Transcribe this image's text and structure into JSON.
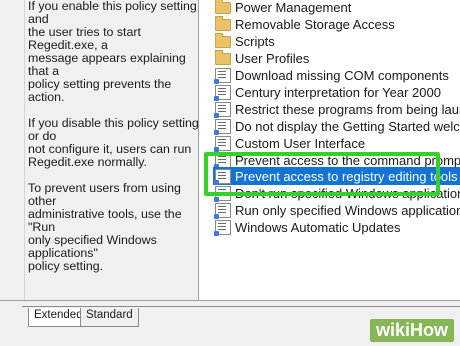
{
  "description": {
    "paragraphs": [
      "If you enable this policy setting and\nthe user tries to start Regedit.exe, a\nmessage appears explaining that a\npolicy setting prevents the action.",
      "If you disable this policy setting or do\nnot configure it, users can run\nRegedit.exe normally.",
      "To prevent users from using other\nadministrative tools, use the \"Run\nonly specified Windows applications\"\npolicy setting."
    ]
  },
  "list": {
    "items": [
      {
        "label": "Power Management",
        "icon": "folder-icon",
        "selected": false
      },
      {
        "label": "Removable Storage Access",
        "icon": "folder-icon",
        "selected": false
      },
      {
        "label": "Scripts",
        "icon": "folder-icon",
        "selected": false
      },
      {
        "label": "User Profiles",
        "icon": "folder-icon",
        "selected": false
      },
      {
        "label": "Download missing COM components",
        "icon": "setting-icon",
        "selected": false
      },
      {
        "label": "Century interpretation for Year 2000",
        "icon": "setting-icon",
        "selected": false
      },
      {
        "label": "Restrict these programs from being launched from",
        "icon": "setting-icon",
        "selected": false
      },
      {
        "label": "Do not display the Getting Started welcome screen",
        "icon": "setting-icon",
        "selected": false
      },
      {
        "label": "Custom User Interface",
        "icon": "setting-icon",
        "selected": false
      },
      {
        "label": "Prevent access to the command prompt",
        "icon": "setting-icon",
        "selected": false
      },
      {
        "label": "Prevent access to registry editing tools",
        "icon": "setting-icon",
        "selected": true
      },
      {
        "label": "Don't run specified Windows applications",
        "icon": "setting-icon",
        "selected": false
      },
      {
        "label": "Run only specified Windows applications",
        "icon": "setting-icon",
        "selected": false
      },
      {
        "label": "Windows Automatic Updates",
        "icon": "setting-icon",
        "selected": false
      }
    ]
  },
  "tabs": {
    "extended": "Extended",
    "standard": "Standard"
  },
  "watermark": "wikiHow",
  "colors": {
    "selection": "#1474d6",
    "highlight_box": "#34d12a"
  }
}
